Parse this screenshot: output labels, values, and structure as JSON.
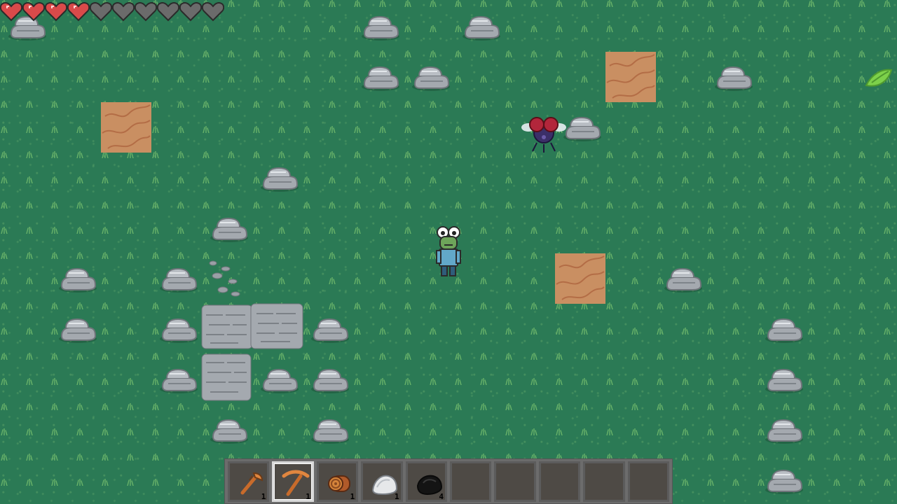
{
  "hud": {
    "health_full": 4,
    "health_max": 10
  },
  "colors": {
    "grass": "#2b7a55",
    "heart_full": "#d94a4a",
    "heart_empty": "#6b6b6b",
    "dirt": "#c98f62",
    "rock": "#9aa0a6"
  },
  "hotbar": {
    "selected_index": 1,
    "slots": [
      {
        "item": "axe-icon",
        "count": "1"
      },
      {
        "item": "pickaxe-icon",
        "count": "1"
      },
      {
        "item": "wood-log-icon",
        "count": "1"
      },
      {
        "item": "stone-icon",
        "count": "1"
      },
      {
        "item": "coal-icon",
        "count": "4"
      },
      {
        "item": "",
        "count": ""
      },
      {
        "item": "",
        "count": ""
      },
      {
        "item": "",
        "count": ""
      },
      {
        "item": "",
        "count": ""
      },
      {
        "item": "",
        "count": ""
      }
    ]
  }
}
